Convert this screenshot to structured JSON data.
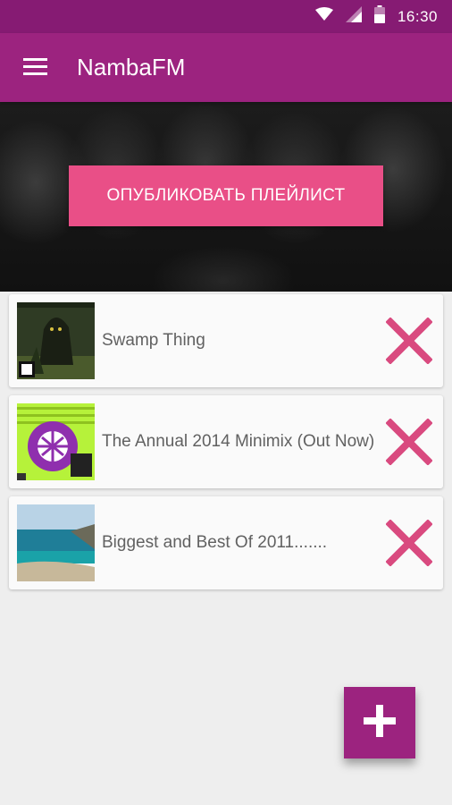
{
  "status_bar": {
    "time": "16:30",
    "icons": [
      "wifi-icon",
      "cell-signal-icon",
      "battery-icon"
    ]
  },
  "app_bar": {
    "title": "NambaFM",
    "menu_icon": "hamburger-menu-icon"
  },
  "hero": {
    "publish_button_label": "ОПУБЛИКОВАТЬ ПЛЕЙЛИСТ"
  },
  "playlist": {
    "items": [
      {
        "title": "Swamp Thing",
        "remove_icon": "close-icon"
      },
      {
        "title": "The Annual 2014 Minimix (Out Now)",
        "remove_icon": "close-icon"
      },
      {
        "title": "Biggest and Best Of 2011.......",
        "remove_icon": "close-icon"
      }
    ]
  },
  "fab": {
    "icon": "plus-icon"
  },
  "colors": {
    "status_bar": "#861b73",
    "app_bar": "#9c237f",
    "accent": "#e94f87",
    "remove_icon": "#d94a7f",
    "fab": "#9c237f"
  }
}
